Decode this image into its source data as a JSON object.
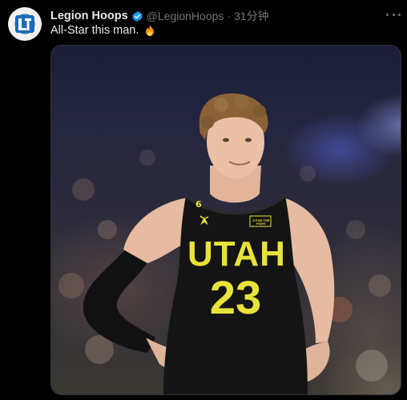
{
  "author": {
    "name": "Legion Hoops",
    "handle": "@LegionHoops",
    "separator": "·",
    "time": "31分钟",
    "verified": true,
    "avatar_icon": "legion-hoops-logo"
  },
  "tweet": {
    "text": "All-Star this man.",
    "emoji_icon": "fire-emoji-icon"
  },
  "media": {
    "type": "photo",
    "jersey_word": "UTAH",
    "jersey_number": "23",
    "shoulder_number": "6",
    "patch_text": "5 FOR THE FIGHT"
  },
  "colors": {
    "background": "#000000",
    "text_primary": "#e7e9ea",
    "text_secondary": "#71767b",
    "verified_blue": "#1d9bf0",
    "jersey_black": "#141414",
    "jersey_yellow": "#e8e33a"
  }
}
